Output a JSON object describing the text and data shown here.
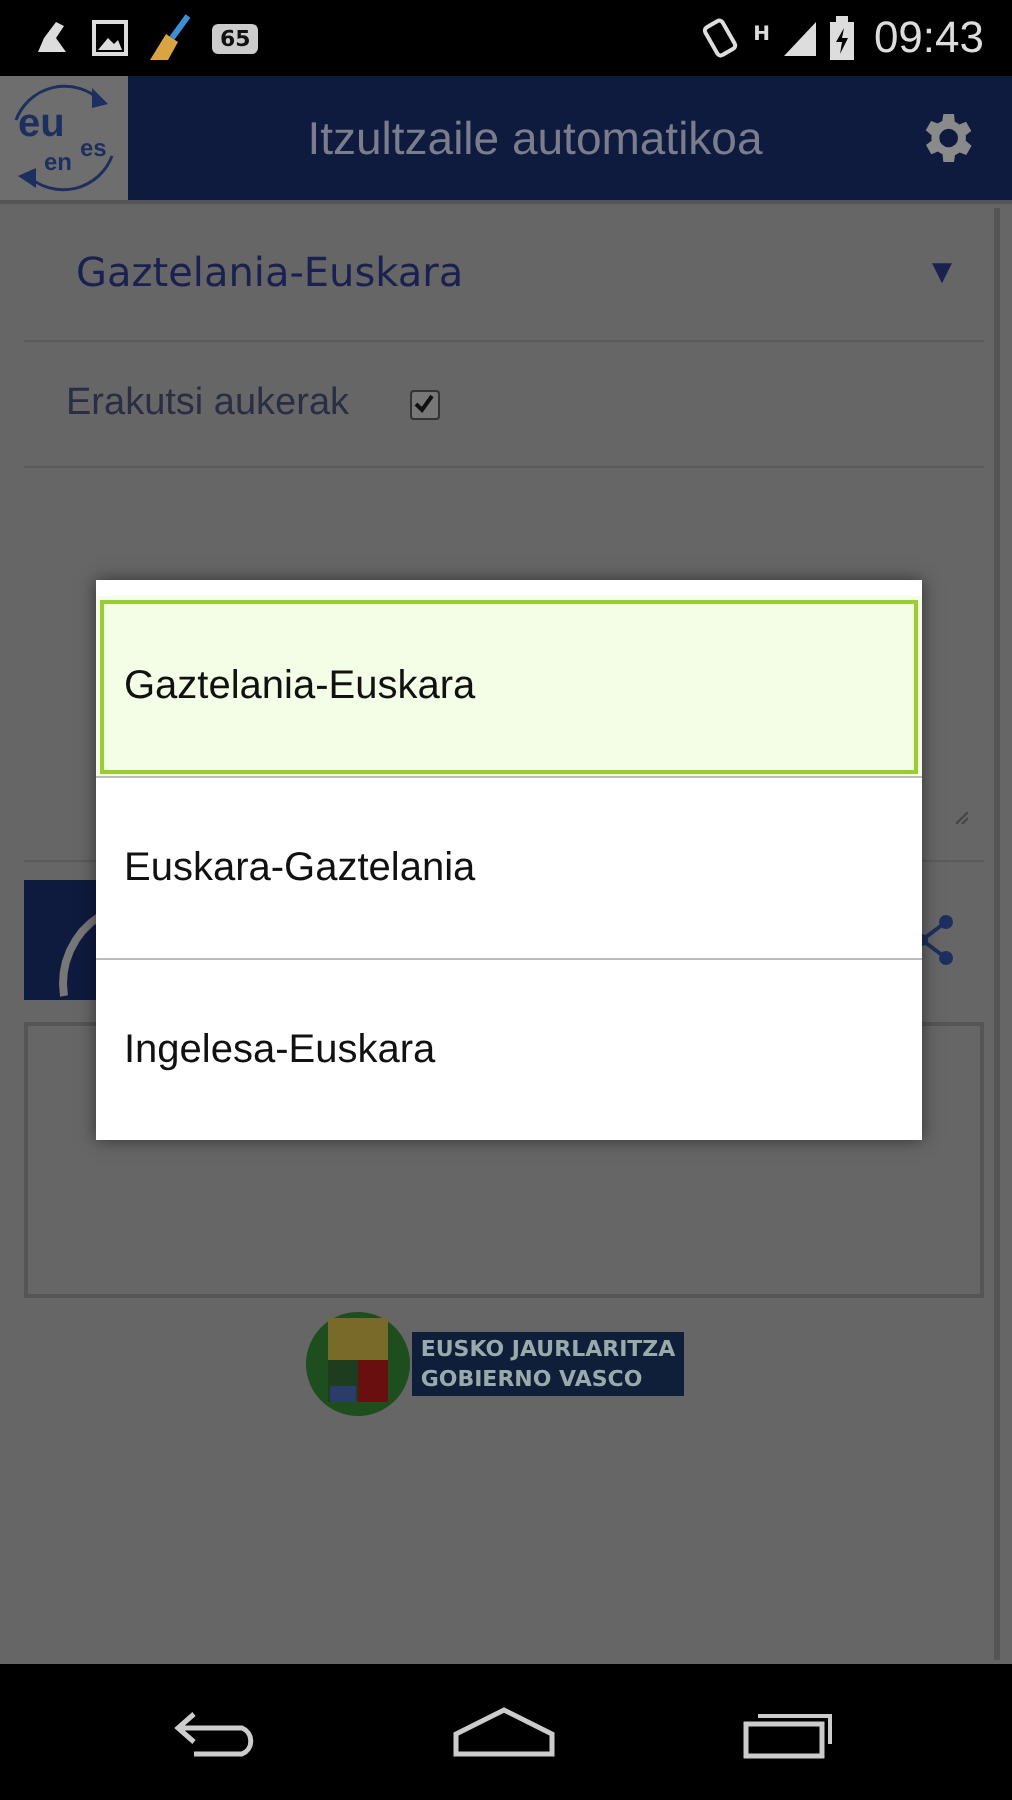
{
  "status_bar": {
    "notification_count": "65",
    "time": "09:43",
    "network": "H"
  },
  "app_bar": {
    "logo_labels": [
      "eu",
      "en",
      "es"
    ],
    "title": "Itzultzaile automatikoa"
  },
  "language_spinner": {
    "value": "Gaztelania-Euskara",
    "arrow": "▼"
  },
  "show_options": {
    "label": "Erakutsi aukerak",
    "checked": true
  },
  "footer_logo": {
    "lines": [
      "EUSKO JAURLARITZA",
      "GOBIERNO VASCO"
    ]
  },
  "dialog": {
    "options": [
      {
        "label": "Gaztelania-Euskara",
        "selected": true
      },
      {
        "label": "Euskara-Gaztelania",
        "selected": false
      },
      {
        "label": "Ingelesa-Euskara",
        "selected": false
      }
    ]
  }
}
